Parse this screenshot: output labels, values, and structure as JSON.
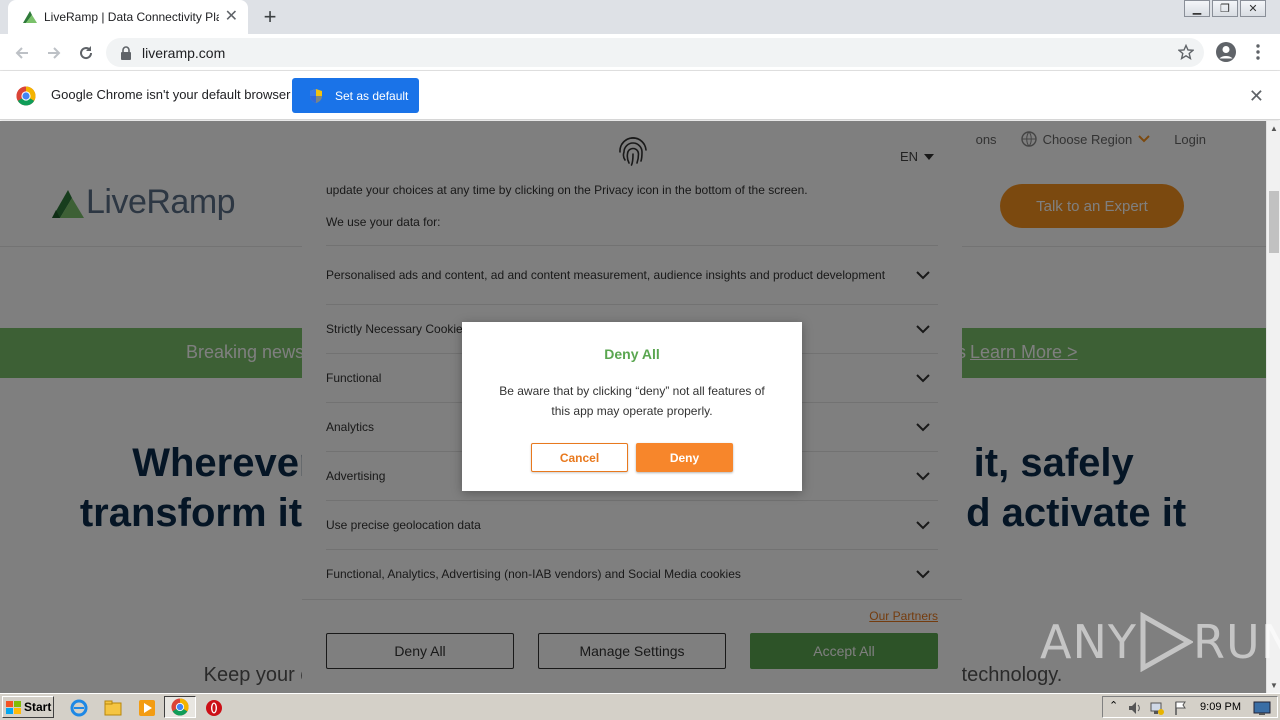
{
  "browser": {
    "tab_title": "LiveRamp | Data Connectivity Platfo",
    "url": "liveramp.com",
    "infobar_text": "Google Chrome isn't your default browser",
    "set_default_label": "Set as default"
  },
  "page": {
    "nav_items": [
      "ons",
      "Choose Region",
      "Login"
    ],
    "logo_text": "LiveRamp",
    "talk_button": "Talk to an Expert",
    "news_left": "Breaking news",
    "news_right": "s",
    "learn_more": "Learn More >",
    "hero_line1_left": "Wherever d",
    "hero_line1_right": "ss it, safely",
    "hero_line2_left": "transform it",
    "hero_line2_right": "d activate it",
    "subhero_left": "Keep your d",
    "subhero_right": "technology."
  },
  "consent": {
    "language": "EN",
    "intro_text": "update your choices at any time by clicking on the Privacy icon in the bottom of the screen.",
    "use_label": "We use your data for:",
    "purposes": [
      "Personalised ads and content, ad and content measurement, audience insights and product development",
      "Strictly Necessary Cookies",
      "Functional",
      "Analytics",
      "Advertising",
      "Use precise geolocation data",
      "Functional, Analytics, Advertising (non-IAB vendors) and Social Media cookies"
    ],
    "partners_link": "Our Partners",
    "deny_all": "Deny All",
    "manage_settings": "Manage Settings",
    "accept_all": "Accept All"
  },
  "modal": {
    "title": "Deny All",
    "body": "Be aware that by clicking “deny” not all features of this app may operate properly.",
    "cancel": "Cancel",
    "deny": "Deny"
  },
  "watermark": {
    "left": "ANY",
    "right": "RUN"
  },
  "taskbar": {
    "start": "Start",
    "clock": "9:09 PM"
  },
  "colors": {
    "accent_orange": "#f7862b",
    "green": "#5aa650",
    "chrome_blue": "#1a73e8"
  }
}
